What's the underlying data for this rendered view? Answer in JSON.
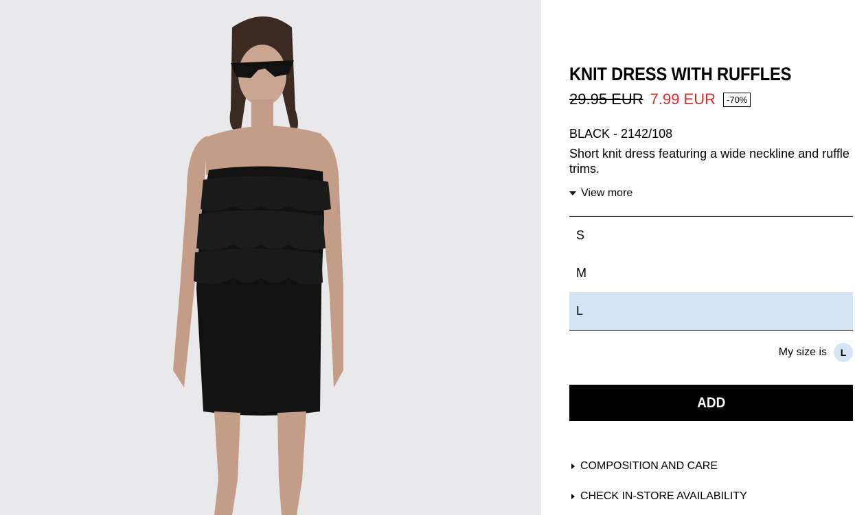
{
  "product": {
    "title": "KNIT DRESS WITH RUFFLES",
    "old_price": "29.95 EUR",
    "new_price": "7.99 EUR",
    "discount": "-70%",
    "color_ref": "BLACK - 2142/108",
    "description": "Short knit dress featuring a wide neckline and ruffle trims.",
    "view_more": "View more"
  },
  "sizes": {
    "options": [
      "S",
      "M",
      "L"
    ],
    "selected": "L"
  },
  "my_size": {
    "label": "My size is",
    "value": "L"
  },
  "actions": {
    "add_label": "ADD"
  },
  "info_links": {
    "composition": "COMPOSITION AND CARE",
    "availability": "CHECK IN-STORE AVAILABILITY"
  },
  "colors": {
    "sale_price": "#e02929",
    "selected_size_bg": "#d5e5f6",
    "image_bg": "#e9e8ea"
  }
}
